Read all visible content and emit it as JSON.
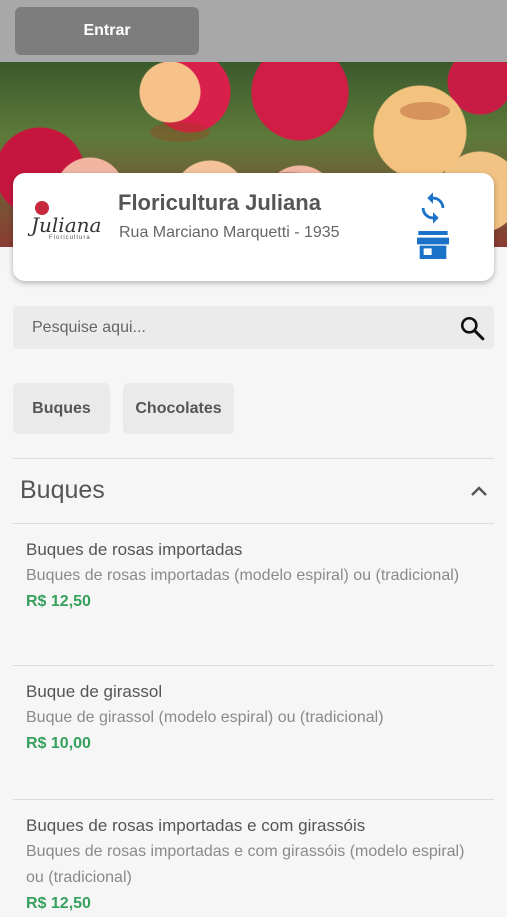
{
  "header": {
    "login_label": "Entrar"
  },
  "store": {
    "name": "Floricultura Juliana",
    "address": "Rua Marciano Marquetti - 1935",
    "logo_text": "Juliana",
    "logo_subtext": "Floricultura",
    "icons": [
      "refresh-icon",
      "store-icon"
    ],
    "accent_color": "#1b73c9"
  },
  "search": {
    "placeholder": "Pesquise aqui..."
  },
  "categories": [
    {
      "label": "Buques"
    },
    {
      "label": "Chocolates"
    }
  ],
  "section": {
    "title": "Buques",
    "items": [
      {
        "name": "Buques de rosas importadas",
        "description": "Buques de rosas importadas (modelo espiral) ou (tradicional)",
        "price": "R$ 12,50"
      },
      {
        "name": "Buque de girassol",
        "description": "Buque de girassol (modelo espiral) ou (tradicional)",
        "price": "R$ 10,00"
      },
      {
        "name": "Buques de rosas importadas e com girassóis",
        "description": "Buques de rosas importadas e com girassóis (modelo espiral) ou (tradicional)",
        "price": "R$ 12,50"
      }
    ]
  },
  "colors": {
    "price": "#37a05e",
    "topbar": "#a8a8a8",
    "button": "#7d7d7d"
  }
}
